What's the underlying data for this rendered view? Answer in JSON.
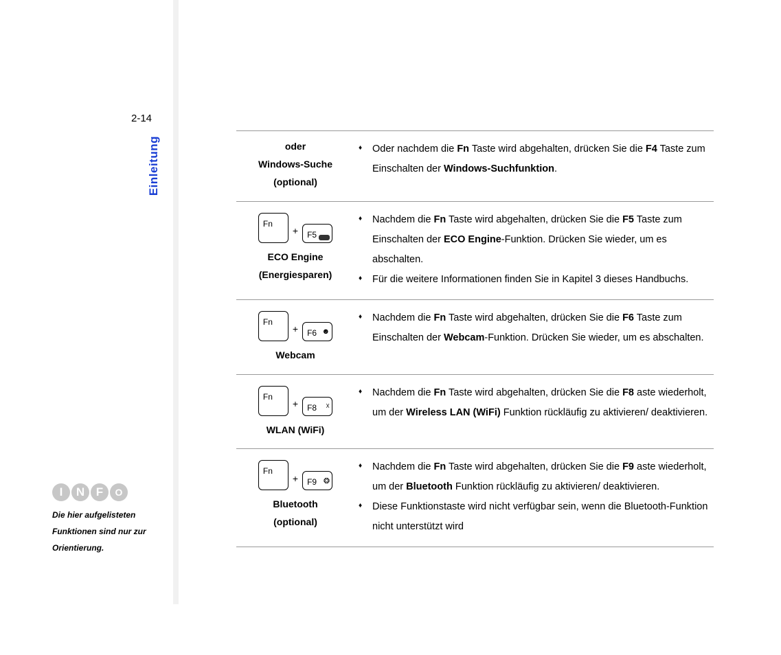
{
  "page_number": "2-14",
  "section_title": "Einleitung",
  "info_logo_letters": [
    "I",
    "N",
    "F",
    "O"
  ],
  "info_note": "Die hier aufgelisteten Funktionen sind nur zur Orientierung.",
  "rows": [
    {
      "left_lines": [
        "oder",
        "Windows-Suche",
        "(optional)"
      ],
      "keys": null,
      "bullets": [
        {
          "pre": "Oder nachdem die ",
          "k1": "Fn",
          "mid1": " Taste wird abgehalten, drücken Sie die ",
          "k2": "F4",
          "mid2": " Taste zum Einschalten der ",
          "strong": "Windows-Suchfunktion",
          "post": "."
        }
      ]
    },
    {
      "left_lines": [
        "ECO Engine",
        "(Energiesparen)"
      ],
      "keys": {
        "fn": "Fn",
        "fx": "F5",
        "icon": "eco"
      },
      "bullets": [
        {
          "pre": "Nachdem die ",
          "k1": "Fn",
          "mid1": " Taste wird abgehalten, drücken Sie die ",
          "k2": "F5",
          "mid2": " Taste zum Einschalten der ",
          "strong": "ECO Engine",
          "post": "-Funktion.   Drücken Sie wieder, um es abschalten."
        },
        {
          "pre": "Für die weitere Informationen finden Sie in Kapitel 3 dieses Handbuchs."
        }
      ]
    },
    {
      "left_lines": [
        "Webcam"
      ],
      "keys": {
        "fn": "Fn",
        "fx": "F6",
        "icon": "cam"
      },
      "bullets": [
        {
          "pre": "Nachdem die ",
          "k1": "Fn",
          "mid1": " Taste wird abgehalten, drücken Sie die ",
          "k2": "F6",
          "mid2": " Taste zum Einschalten der ",
          "strong": "Webcam",
          "post": "-Funktion. Drücken Sie wieder, um es abschalten."
        }
      ]
    },
    {
      "left_lines": [
        "WLAN (WiFi)"
      ],
      "keys": {
        "fn": "Fn",
        "fx": "F8",
        "icon": "wifi"
      },
      "bullets": [
        {
          "pre": "Nachdem die ",
          "k1": "Fn",
          "mid1": " Taste wird abgehalten, drücken Sie die ",
          "k2": "F8",
          "mid2": " aste wiederholt, um der ",
          "strong": "Wireless LAN (WiFi)",
          "post": " Funktion rückläufig zu aktivieren/ deaktivieren."
        }
      ]
    },
    {
      "left_lines": [
        "Bluetooth",
        "(optional)"
      ],
      "keys": {
        "fn": "Fn",
        "fx": "F9",
        "icon": "bt"
      },
      "bullets": [
        {
          "pre": "Nachdem die ",
          "k1": "Fn",
          "mid1": " Taste wird abgehalten, drücken Sie die ",
          "k2": "F9",
          "mid2": " aste wiederholt, um der ",
          "strong": "Bluetooth",
          "post": " Funktion rückläufig zu aktivieren/ deaktivieren."
        },
        {
          "pre": "Diese Funktionstaste wird nicht verfügbar sein, wenn die Bluetooth-Funktion nicht unterstützt wird"
        }
      ]
    }
  ]
}
